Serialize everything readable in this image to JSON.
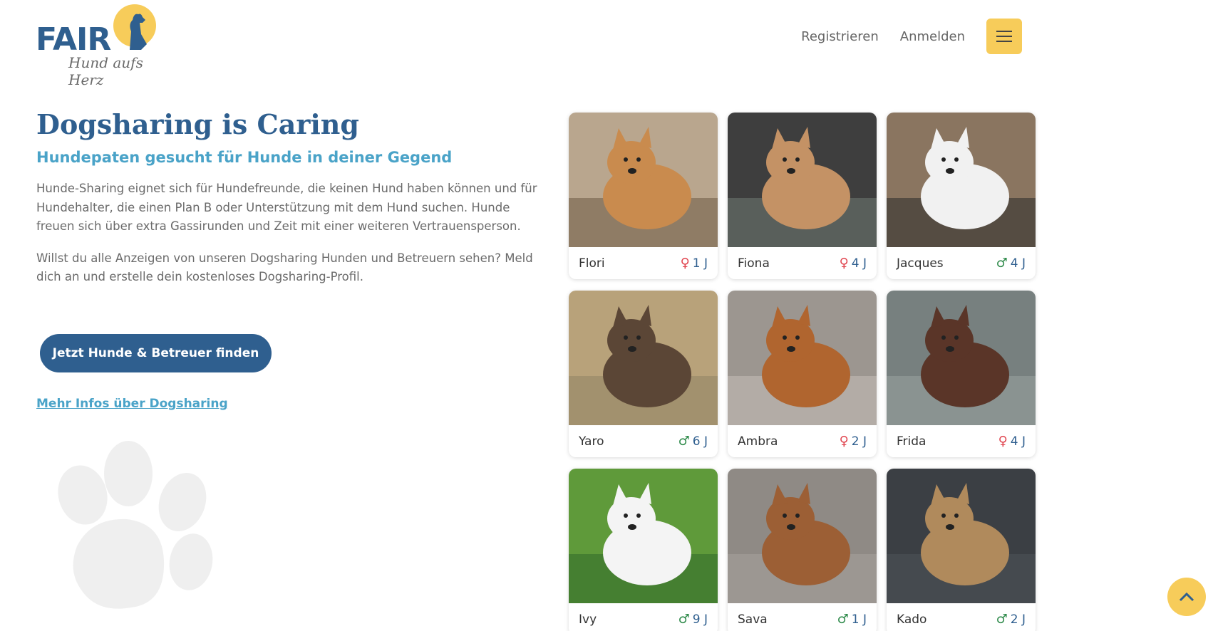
{
  "brand": {
    "word": "FAIR",
    "tagline": "Hund aufs Herz"
  },
  "nav": {
    "register": "Registrieren",
    "login": "Anmelden",
    "menu_icon": "hamburger-icon"
  },
  "intro": {
    "title": "Dogsharing is Caring",
    "subtitle": "Hundepaten gesucht für Hunde in deiner Gegend",
    "para1": "Hunde-Sharing eignet sich für Hundefreunde, die keinen Hund haben können und für Hundehalter, die einen Plan B oder Unterstützung mit dem Hund suchen. Hunde freuen sich über extra Gassirunden und Zeit mit einer weiteren Vertrauensperson.",
    "para2": "Willst du alle Anzeigen von unseren Dogsharing Hunden und Betreuern sehen? Meld dich an und erstelle dein kostenloses Dogsharing-Profil.",
    "cta": "Jetzt Hunde & Betreuer finden",
    "more": "Mehr Infos über Dogsharing"
  },
  "dogs": [
    {
      "name": "Flori",
      "sex": "female",
      "age": "1 J",
      "colors": [
        "#b9a68e",
        "#c98b4e",
        "#6d5a44"
      ]
    },
    {
      "name": "Fiona",
      "sex": "female",
      "age": "4 J",
      "colors": [
        "#3e3e3e",
        "#c49265",
        "#6f7a73"
      ]
    },
    {
      "name": "Jacques",
      "sex": "male",
      "age": "4 J",
      "colors": [
        "#8a7560",
        "#f1f1f1",
        "#2a2a2a"
      ]
    },
    {
      "name": "Yaro",
      "sex": "male",
      "age": "6 J",
      "colors": [
        "#b8a27a",
        "#5b4636",
        "#8f8465"
      ]
    },
    {
      "name": "Ambra",
      "sex": "female",
      "age": "2 J",
      "colors": [
        "#9c9690",
        "#b0652f",
        "#c7c0b8"
      ]
    },
    {
      "name": "Frida",
      "sex": "female",
      "age": "4 J",
      "colors": [
        "#77807f",
        "#5a3528",
        "#9aa2a1"
      ]
    },
    {
      "name": "Ivy",
      "sex": "male",
      "age": "9 J",
      "colors": [
        "#5f9a3a",
        "#f4f4f4",
        "#2f6a2a"
      ]
    },
    {
      "name": "Sava",
      "sex": "male",
      "age": "1 J",
      "colors": [
        "#8f8a85",
        "#9c5f35",
        "#a7a29c"
      ]
    },
    {
      "name": "Kado",
      "sex": "male",
      "age": "2 J",
      "colors": [
        "#3b3f44",
        "#b08a5c",
        "#4e545a"
      ]
    }
  ],
  "scroll_top_icon": "chevron-up-icon",
  "colors": {
    "primary": "#2f5f8f",
    "accent": "#f7cc5a",
    "link": "#4aa3c8"
  }
}
